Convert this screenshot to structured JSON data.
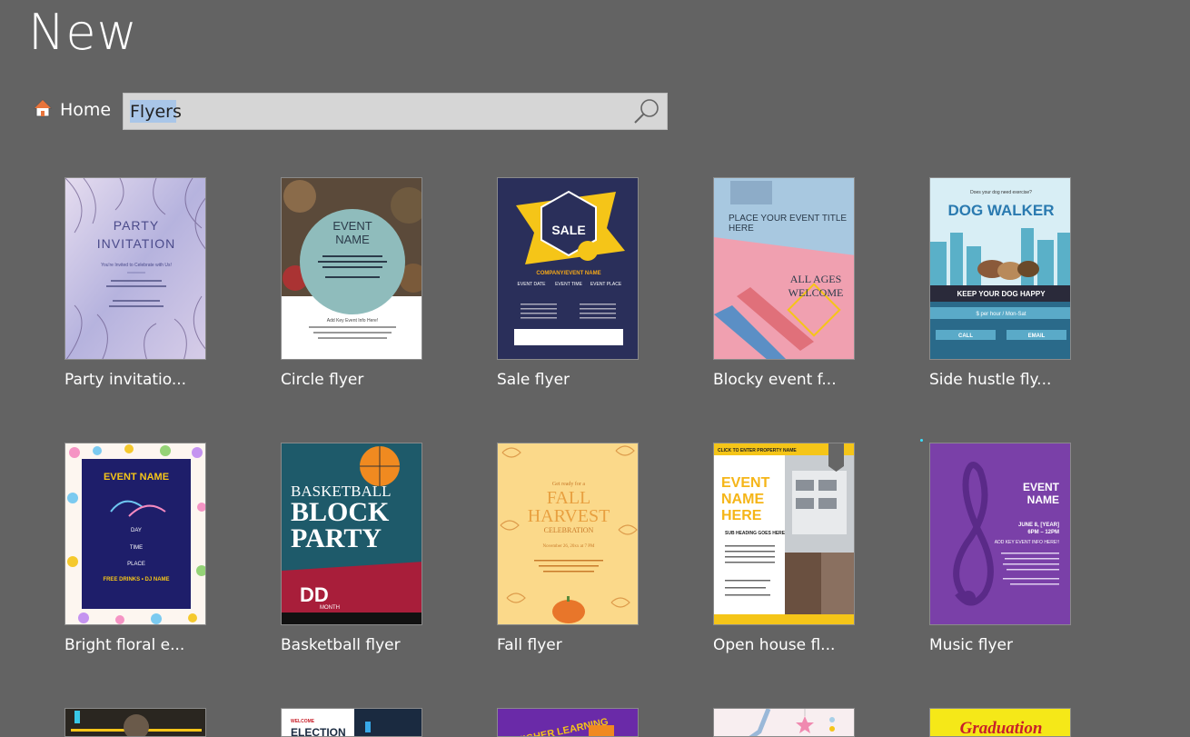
{
  "header": {
    "title": "New"
  },
  "nav": {
    "home_label": "Home"
  },
  "search": {
    "value": "Flyers"
  },
  "templates": [
    {
      "label": "Party invitatio...",
      "thumb_text": [
        "PARTY",
        "INVITATION",
        "You're Invited to Celebrate with Us!"
      ]
    },
    {
      "label": "Circle flyer",
      "thumb_text": [
        "EVENT",
        "NAME",
        "Add Key Event Info Here!"
      ]
    },
    {
      "label": "Sale flyer",
      "thumb_text": [
        "SALE",
        "COMPANY/EVENT NAME",
        "EVENT DATE",
        "EVENT TIME",
        "EVENT PLACE"
      ]
    },
    {
      "label": "Blocky event f...",
      "thumb_text": [
        "PLACE YOUR EVENT TITLE",
        "HERE",
        "ALL AGES",
        "WELCOME"
      ]
    },
    {
      "label": "Side hustle fly...",
      "thumb_text": [
        "Does your dog need exercise?",
        "DOG WALKER",
        "KEEP YOUR DOG HAPPY",
        "$ per hour / Mon-Sat",
        "CALL",
        "EMAIL"
      ]
    },
    {
      "label": "Bright floral e...",
      "thumb_text": [
        "EVENT NAME",
        "DAY",
        "TIME",
        "PLACE",
        "FREE DRINKS • DJ NAME"
      ]
    },
    {
      "label": "Basketball flyer",
      "thumb_text": [
        "BASKETBALL",
        "BLOCK",
        "PARTY",
        "DD",
        "MONTH"
      ]
    },
    {
      "label": "Fall flyer",
      "thumb_text": [
        "Get ready for a",
        "FALL",
        "HARVEST",
        "CELEBRATION",
        "November 26, 20xx at 7 PM"
      ]
    },
    {
      "label": "Open house fl...",
      "thumb_text": [
        "CLICK TO ENTER PROPERTY NAME",
        "EVENT",
        "NAME",
        "HERE",
        "SUB HEADING GOES HERE"
      ]
    },
    {
      "label": "Music flyer",
      "thumb_text": [
        "EVENT",
        "NAME",
        "JUNE 8, [YEAR]",
        "6PM – 12PM",
        "ADD KEY EVENT INFO HERE!!"
      ]
    },
    {
      "label": "",
      "thumb_text": []
    },
    {
      "label": "",
      "thumb_text": [
        "WELCOME",
        "ELECTION"
      ]
    },
    {
      "label": "",
      "thumb_text": [
        "HIGHER LEARNING"
      ]
    },
    {
      "label": "",
      "thumb_text": []
    },
    {
      "label": "",
      "thumb_text": [
        "Graduation"
      ]
    }
  ],
  "colors": {
    "background": "#636363",
    "search_bg": "#d6d6d6",
    "selection": "#a9c6e8"
  }
}
